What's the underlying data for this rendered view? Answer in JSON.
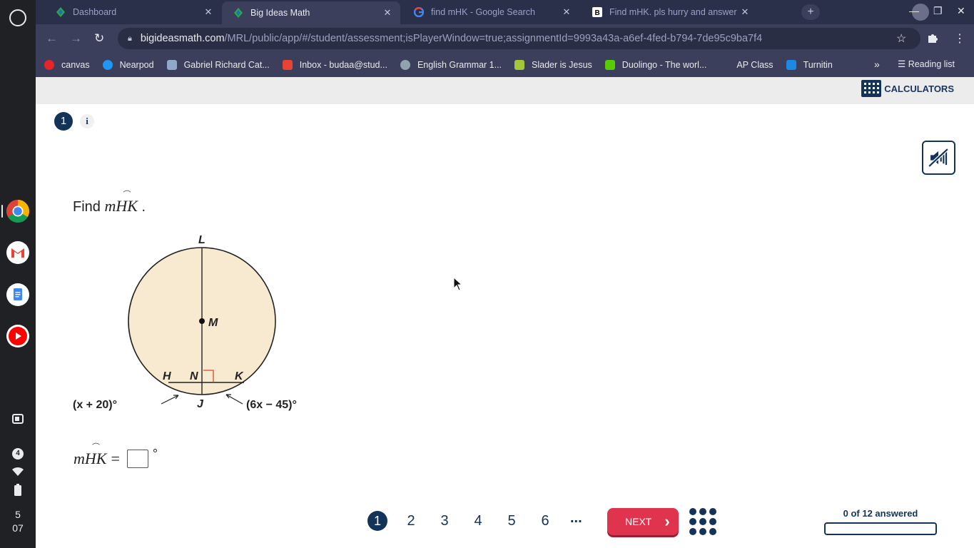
{
  "shelf": {
    "apps": [
      "chrome",
      "gmail",
      "google-docs",
      "youtube"
    ],
    "notification_count": "4",
    "clock_hour": "5",
    "clock_minute": "07"
  },
  "tabs": [
    {
      "title": "Dashboard",
      "favicon": "big-ideas-math",
      "active": false
    },
    {
      "title": "Big Ideas Math",
      "favicon": "big-ideas-math",
      "active": true
    },
    {
      "title": "find mHK - Google Search",
      "favicon": "google",
      "active": false
    },
    {
      "title": "Find mHK. pls hurry and answer",
      "favicon": "brainly",
      "active": false
    }
  ],
  "address_bar": {
    "host": "bigideasmath.com",
    "path": "/MRL/public/app/#/student/assessment;isPlayerWindow=true;assignmentId=9993a43a-a6ef-4fed-b794-7de95c9ba7f4"
  },
  "bookmarks": [
    {
      "label": "canvas",
      "color": "#e72429"
    },
    {
      "label": "Nearpod",
      "color": "#2196f3"
    },
    {
      "label": "Gabriel Richard Cat...",
      "color": "#8fa8c8"
    },
    {
      "label": "Inbox - budaa@stud...",
      "color": "#ea4335"
    },
    {
      "label": "English Grammar 1...",
      "color": "#90a4ae"
    },
    {
      "label": "Slader is Jesus",
      "color": "#a4c639"
    },
    {
      "label": "Duolingo - The worl...",
      "color": "#58cc02"
    },
    {
      "label": "AP Class",
      "color": "#3b3f5c"
    },
    {
      "label": "Turnitin",
      "color": "#1e88e5"
    }
  ],
  "bookmarks_more": "»",
  "reading_list": "Reading list",
  "header": {
    "calculators_label": "CALCULATORS"
  },
  "question": {
    "number": "1",
    "info_label": "i",
    "prompt_text": "Find",
    "prompt_math": "mHK",
    "prompt_end": ".",
    "answer_lhs": "mHK",
    "answer_eq": "=",
    "answer_value": "",
    "answer_unit": "°"
  },
  "diagram": {
    "labels": {
      "L": "L",
      "M": "M",
      "H": "H",
      "N": "N",
      "K": "K",
      "J": "J"
    },
    "left_arc_expr": "(x + 20)°",
    "right_arc_expr": "(6x − 45)°",
    "fill_color": "#f7ead0"
  },
  "pager": {
    "pages": [
      "1",
      "2",
      "3",
      "4",
      "5",
      "6"
    ],
    "current": "1",
    "ellipsis": "...",
    "next_label": "NEXT"
  },
  "progress": {
    "label": "0 of 12 answered",
    "answered": 0,
    "total": 12
  },
  "colors": {
    "navy": "#143359",
    "next_red": "#e0334e"
  }
}
